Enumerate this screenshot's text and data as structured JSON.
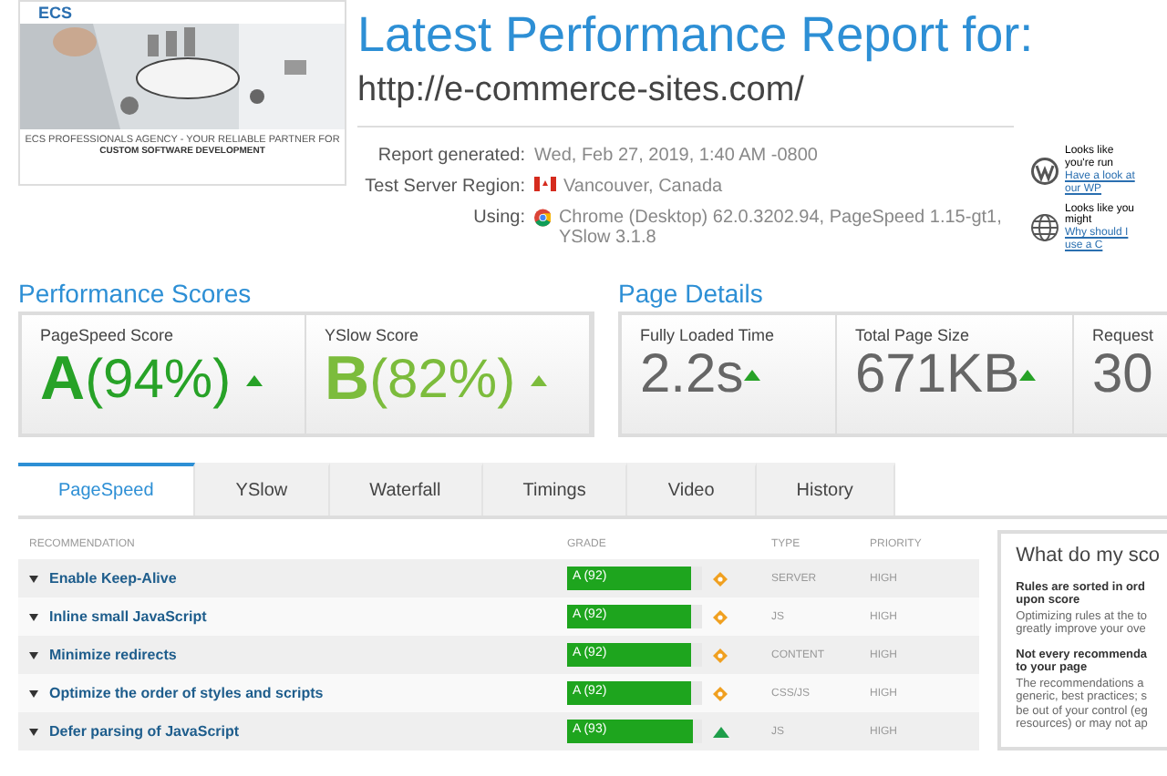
{
  "thumbnail": {
    "logo": "ECS",
    "tagline": "ECS PROFESSIONALS AGENCY - YOUR RELIABLE PARTNER FOR",
    "headline": "CUSTOM SOFTWARE DEVELOPMENT",
    "kind": "picture"
  },
  "report": {
    "title": "Latest Performance Report for:",
    "url": "http://e-commerce-sites.com/",
    "info": [
      {
        "label": "Report generated:",
        "value": "Wed, Feb 27, 2019, 1:40 AM -0800",
        "kind": "text"
      },
      {
        "label": "Test Server Region:",
        "value": "Vancouver, Canada",
        "kind": "flag"
      },
      {
        "label": "Using:",
        "value": "Chrome (Desktop) 62.0.3202.94, PageSpeed 1.15-gt1, YSlow 3.1.8",
        "kind": "browser"
      }
    ]
  },
  "notices": [
    {
      "kind": "wordpress",
      "text": "Looks like you're run",
      "link": "Have a look at our WP"
    },
    {
      "kind": "globe",
      "text": "Looks like you might",
      "link": "Why should I use a C"
    }
  ],
  "performance_scores": {
    "title": "Performance Scores",
    "items": [
      {
        "label": "PageSpeed Score",
        "grade": "A",
        "value": "(94%)",
        "color": "#27a227"
      },
      {
        "label": "YSlow Score",
        "grade": "B",
        "value": "(82%)",
        "color": "#7cbc3c"
      }
    ]
  },
  "page_details": {
    "title": "Page Details",
    "items": [
      {
        "label": "Fully Loaded Time",
        "value": "2.2s",
        "arrow": true
      },
      {
        "label": "Total Page Size",
        "value": "671KB",
        "arrow": true
      },
      {
        "label": "Request",
        "value": "30"
      }
    ]
  },
  "tabs": [
    {
      "label": "PageSpeed",
      "selected": true
    },
    {
      "label": "YSlow",
      "selected": false
    },
    {
      "label": "Waterfall",
      "selected": false
    },
    {
      "label": "Timings",
      "selected": false
    },
    {
      "label": "Video",
      "selected": false
    },
    {
      "label": "History",
      "selected": false
    }
  ],
  "table": {
    "columns": [
      "RECOMMENDATION",
      "GRADE",
      "TYPE",
      "PRIORITY"
    ],
    "rows": [
      {
        "name": "Enable Keep-Alive",
        "grade": "A (92)",
        "level": 0.92,
        "kind": "diamond",
        "type": "SERVER",
        "priority": "HIGH"
      },
      {
        "name": "Inline small JavaScript",
        "grade": "A (92)",
        "level": 0.92,
        "kind": "diamond",
        "type": "JS",
        "priority": "HIGH"
      },
      {
        "name": "Minimize redirects",
        "grade": "A (92)",
        "level": 0.92,
        "kind": "diamond",
        "type": "CONTENT",
        "priority": "HIGH"
      },
      {
        "name": "Optimize the order of styles and scripts",
        "grade": "A (92)",
        "level": 0.92,
        "kind": "diamond",
        "type": "CSS/JS",
        "priority": "HIGH"
      },
      {
        "name": "Defer parsing of JavaScript",
        "grade": "A (93)",
        "level": 0.93,
        "kind": "up",
        "type": "JS",
        "priority": "HIGH"
      }
    ]
  },
  "sidebar": {
    "title": "What do my sco",
    "sections": [
      {
        "heading": "Rules are sorted in ord upon score",
        "body": "Optimizing rules at the to greatly improve your ove"
      },
      {
        "heading": "Not every recommenda to your page",
        "body": "The recommendations a generic, best practices; s be out of your control (eg resources) or may not ap"
      }
    ]
  }
}
